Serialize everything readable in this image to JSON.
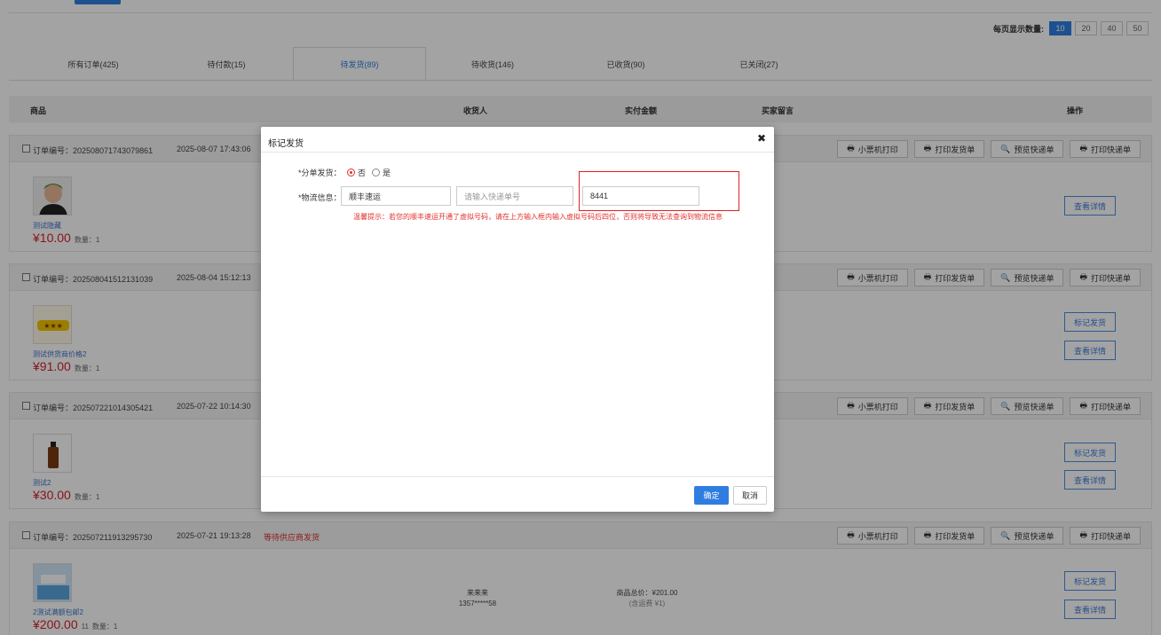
{
  "page_size": {
    "label": "每页显示数量:",
    "options": [
      "10",
      "20",
      "40",
      "50"
    ],
    "selected": "10"
  },
  "tabs": [
    {
      "label": "所有订单(425)"
    },
    {
      "label": "待付款(15)"
    },
    {
      "label": "待发货(89)"
    },
    {
      "label": "待收货(146)"
    },
    {
      "label": "已收货(90)"
    },
    {
      "label": "已关闭(27)"
    }
  ],
  "active_tab": "待发货(89)",
  "table_header": {
    "product": "商品",
    "receiver": "收货人",
    "paid": "实付金额",
    "buyer_msg": "买家留言",
    "ops": "操作"
  },
  "order_actions": [
    "小票机打印",
    "打印发货单",
    "预览快递单",
    "打印快递单"
  ],
  "orders": [
    {
      "no_label": "订单编号：202508071743079861",
      "time": "2025-08-07 17:43:06",
      "status": "",
      "product": "测试隐藏",
      "price": "¥10.00",
      "qty": "数量：1",
      "buttons": [
        "查看详情"
      ]
    },
    {
      "no_label": "订单编号：202508041512131039",
      "time": "2025-08-04 15:12:13",
      "status": "",
      "product": "测试供货商价格2",
      "price": "¥91.00",
      "qty": "数量：1",
      "buttons": [
        "标记发货",
        "查看详情"
      ]
    },
    {
      "no_label": "订单编号：202507221014305421",
      "time": "2025-07-22 10:14:30",
      "status": "",
      "product": "测试2",
      "price": "¥30.00",
      "qty": "数量：1",
      "buttons": [
        "标记发货",
        "查看详情"
      ]
    },
    {
      "no_label": "订单编号：202507211913295730",
      "time": "2025-07-21 19:13:28",
      "status": "等待供应商发货",
      "product": "2测试满额包邮2",
      "price": "¥200.00",
      "price_extra": "11",
      "qty": "数量：1",
      "receiver_name": "来来来",
      "receiver_phone": "1357*****58",
      "total": "商品总价：¥201.00",
      "total_sub": "(含运费 ¥1)",
      "buttons": [
        "标记发货",
        "查看详情"
      ]
    }
  ],
  "modal": {
    "title": "标记发货",
    "close": "✖",
    "split_label": "*分单发货：",
    "split_options": [
      "否",
      "是"
    ],
    "split_selected": "否",
    "logistics_label": "*物流信息：",
    "courier": "顺丰速运",
    "tracking_placeholder": "请输入快递单号",
    "virtual_digits": "8441",
    "tip": "温馨提示：若您的顺丰速运开通了虚拟号码，请在上方输入框内输入虚拟号码后四位，否则将导致无法查询到物流信息",
    "ok": "确定",
    "cancel": "取消"
  },
  "colors": {
    "accent": "#2f7de1",
    "price": "#d6202d",
    "warning": "#e0312e",
    "highlight": "#e02020"
  }
}
